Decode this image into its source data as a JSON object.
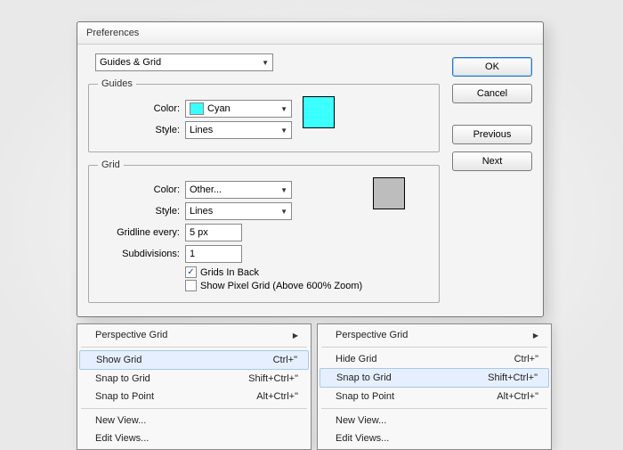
{
  "dialog": {
    "title": "Preferences",
    "category": "Guides & Grid",
    "guides": {
      "legend": "Guides",
      "color_label": "Color:",
      "color_value": "Cyan",
      "color_chip": "#3cffff",
      "style_label": "Style:",
      "style_value": "Lines",
      "swatch": "#3cffff"
    },
    "grid": {
      "legend": "Grid",
      "color_label": "Color:",
      "color_value": "Other...",
      "style_label": "Style:",
      "style_value": "Lines",
      "gridline_label": "Gridline every:",
      "gridline_value": "5 px",
      "subdiv_label": "Subdivisions:",
      "subdiv_value": "1",
      "grids_in_back": "Grids In Back",
      "show_pixel_grid": "Show Pixel Grid (Above 600% Zoom)",
      "swatch": "#bdbdbd"
    },
    "buttons": {
      "ok": "OK",
      "cancel": "Cancel",
      "previous": "Previous",
      "next": "Next"
    }
  },
  "menu_left": {
    "perspective": "Perspective Grid",
    "items": [
      {
        "label": "Show Grid",
        "shortcut": "Ctrl+\"",
        "hl": true
      },
      {
        "label": "Snap to Grid",
        "shortcut": "Shift+Ctrl+\"",
        "hl": false
      },
      {
        "label": "Snap to Point",
        "shortcut": "Alt+Ctrl+\"",
        "hl": false
      }
    ],
    "newview": "New View...",
    "editviews": "Edit Views..."
  },
  "menu_right": {
    "perspective": "Perspective Grid",
    "items": [
      {
        "label": "Hide Grid",
        "shortcut": "Ctrl+\"",
        "hl": false
      },
      {
        "label": "Snap to Grid",
        "shortcut": "Shift+Ctrl+\"",
        "hl": true
      },
      {
        "label": "Snap to Point",
        "shortcut": "Alt+Ctrl+\"",
        "hl": false
      }
    ],
    "newview": "New View...",
    "editviews": "Edit Views..."
  }
}
